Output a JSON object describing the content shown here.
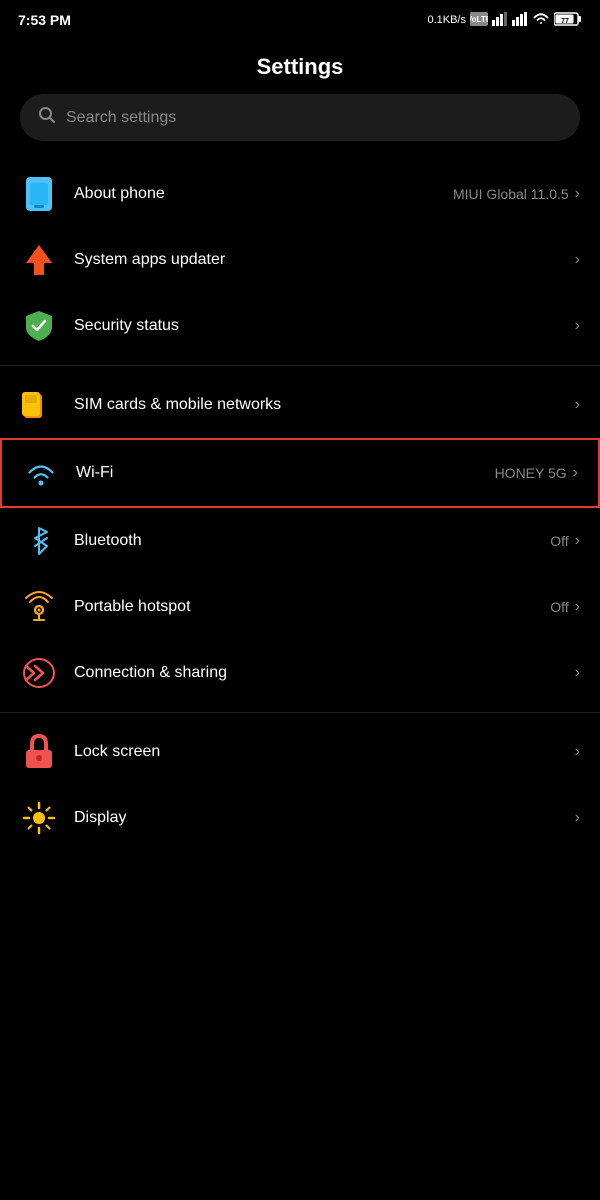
{
  "statusBar": {
    "time": "7:53 PM",
    "network": "0.1KB/s",
    "carrier1": "VoLTE",
    "battery": "77"
  },
  "header": {
    "title": "Settings"
  },
  "search": {
    "placeholder": "Search settings"
  },
  "groups": [
    {
      "id": "system",
      "items": [
        {
          "id": "about-phone",
          "label": "About phone",
          "value": "MIUI Global 11.0.5",
          "icon": "phone-icon",
          "highlighted": false
        },
        {
          "id": "system-apps-updater",
          "label": "System apps updater",
          "value": "",
          "icon": "arrow-up-icon",
          "highlighted": false
        },
        {
          "id": "security-status",
          "label": "Security status",
          "value": "",
          "icon": "shield-icon",
          "highlighted": false
        }
      ]
    },
    {
      "id": "connectivity",
      "items": [
        {
          "id": "sim-cards",
          "label": "SIM cards & mobile networks",
          "value": "",
          "icon": "sim-icon",
          "highlighted": false
        },
        {
          "id": "wifi",
          "label": "Wi-Fi",
          "value": "HONEY 5G",
          "icon": "wifi-icon",
          "highlighted": true
        },
        {
          "id": "bluetooth",
          "label": "Bluetooth",
          "value": "Off",
          "icon": "bluetooth-icon",
          "highlighted": false
        },
        {
          "id": "portable-hotspot",
          "label": "Portable hotspot",
          "value": "Off",
          "icon": "hotspot-icon",
          "highlighted": false
        },
        {
          "id": "connection-sharing",
          "label": "Connection & sharing",
          "value": "",
          "icon": "connection-icon",
          "highlighted": false
        }
      ]
    },
    {
      "id": "personalization",
      "items": [
        {
          "id": "lock-screen",
          "label": "Lock screen",
          "value": "",
          "icon": "lock-icon",
          "highlighted": false
        },
        {
          "id": "display",
          "label": "Display",
          "value": "",
          "icon": "display-icon",
          "highlighted": false
        }
      ]
    }
  ],
  "chevron": "›"
}
